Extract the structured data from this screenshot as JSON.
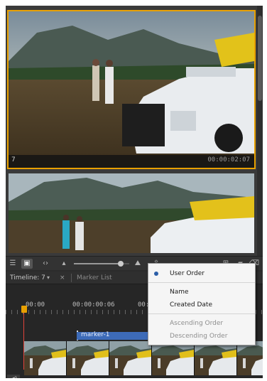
{
  "project": {
    "clips": [
      {
        "name": "7",
        "duration": "00:00:02:07"
      },
      {
        "name": "",
        "duration": ""
      }
    ]
  },
  "toolbar": {
    "list_view_icon": "list-icon",
    "icon_view_icon": "grid-icon",
    "fit_icon": "fit-icon",
    "zoom_level": 0.85,
    "sort_icon": "sort-icon",
    "bin_icon": "bin-icon",
    "folder_icon": "folder-icon",
    "delete_icon": "trash-icon"
  },
  "timeline": {
    "tabs": [
      {
        "label": "Timeline: 7",
        "active": true
      },
      {
        "label": "Marker List",
        "active": false
      }
    ],
    "dropdown_glyph": "▾",
    "close_glyph": "×",
    "ruler": [
      {
        "label": "00:00"
      },
      {
        "label": "00:00:00:06"
      },
      {
        "label": "00:00:00:12"
      }
    ],
    "marker_label": "marker-1",
    "audio_icon": "speaker-icon"
  },
  "sort_menu": {
    "items": [
      {
        "label": "User Order",
        "checked": true,
        "enabled": true
      },
      {
        "label": "Name",
        "checked": false,
        "enabled": true
      },
      {
        "label": "Created Date",
        "checked": false,
        "enabled": true
      },
      {
        "label": "Ascending Order",
        "checked": false,
        "enabled": false
      },
      {
        "label": "Descending Order",
        "checked": false,
        "enabled": false
      }
    ]
  },
  "colors": {
    "accent": "#e8a000",
    "playhead": "#e0433a",
    "marker": "#3d6bb8"
  }
}
